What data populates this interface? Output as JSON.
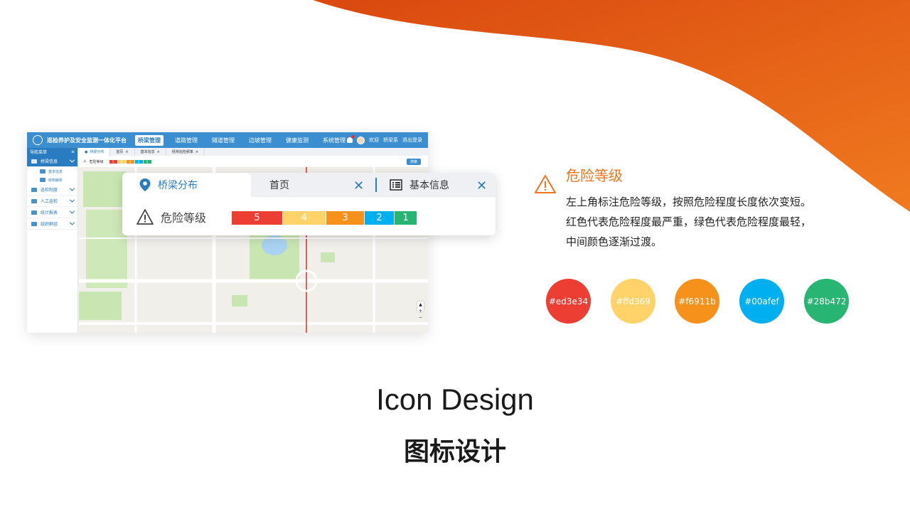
{
  "mock": {
    "app_title": "巡检养护及安全监测一体化平台",
    "nav": [
      "桥梁管理",
      "道路管理",
      "隧道管理",
      "边坡管理",
      "健康监测",
      "系统管理"
    ],
    "user_greeting": "欢迎",
    "user_name": "桥梁系",
    "logout": "退出登录",
    "side_header": "导航菜单",
    "side_items": [
      {
        "label": "桥梁信息"
      },
      {
        "label": "巡检制度"
      },
      {
        "label": "人工巡检"
      },
      {
        "label": "统计报表"
      },
      {
        "label": "组织群组"
      }
    ],
    "side_subitems": [
      "基本信息",
      "结构解析"
    ],
    "tabs": [
      "桥梁分布",
      "首页",
      "基本信息",
      "经常巡检频率"
    ],
    "danger_label": "危险等级",
    "mini_levels": [
      "5",
      "4",
      "3",
      "2",
      "1"
    ],
    "search_label": "搜索",
    "map_controls": [
      "▲",
      "+",
      "−"
    ]
  },
  "zoom": {
    "tabs": [
      {
        "label": "桥梁分布",
        "icon": "map-pin-icon"
      },
      {
        "label": "首页",
        "icon": "close-icon"
      },
      {
        "label": "基本信息",
        "icon": "list-icon"
      }
    ],
    "danger_label": "危险等级",
    "levels": [
      {
        "value": "5",
        "color": "#ed3e34"
      },
      {
        "value": "4",
        "color": "#ffd369"
      },
      {
        "value": "3",
        "color": "#f6911b"
      },
      {
        "value": "2",
        "color": "#00afef"
      },
      {
        "value": "1",
        "color": "#28b472"
      }
    ]
  },
  "description": {
    "title": "危险等级",
    "lines": [
      "左上角标注危险等级，按照危险程度长度依次变短。",
      "红色代表危险程度最严重，绿色代表危险程度最轻，",
      "中间颜色逐渐过渡。"
    ],
    "accent_color": "#f0751c"
  },
  "swatches": [
    {
      "label": "#ed3e34",
      "color": "#ed3e34"
    },
    {
      "label": "#ffd369",
      "color": "#ffd369"
    },
    {
      "label": "#f6911b",
      "color": "#f6911b"
    },
    {
      "label": "#00afef",
      "color": "#00afef"
    },
    {
      "label": "#28b472",
      "color": "#28b472"
    }
  ],
  "heading_en": "Icon Design",
  "heading_cn": "图标设计"
}
